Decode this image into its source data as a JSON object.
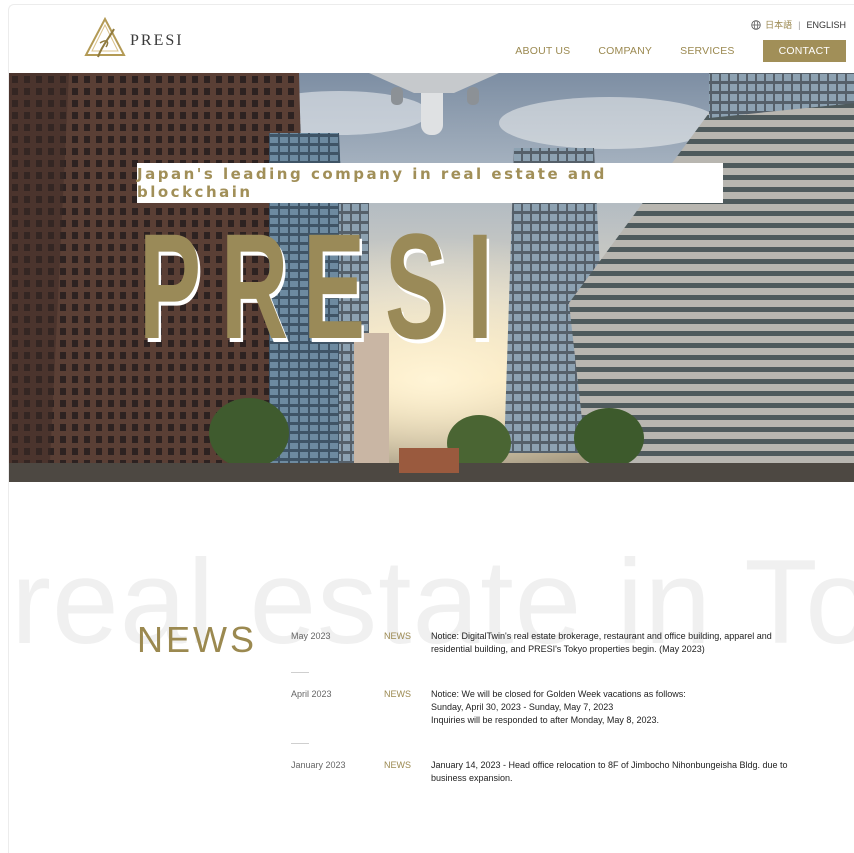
{
  "header": {
    "logo_text": "PRESI",
    "lang_japanese": "日本語",
    "lang_separator": "|",
    "lang_english": "ENGLISH",
    "nav": [
      "ABOUT US",
      "COMPANY",
      "SERVICES"
    ],
    "contact_label": "CONTACT"
  },
  "hero": {
    "tagline": "Japan's leading company in real estate and blockchain",
    "big_letters": [
      "P",
      "R",
      "E",
      "S",
      "I"
    ]
  },
  "news": {
    "watermark": "real estate in Tok",
    "title": "NEWS",
    "items": [
      {
        "date": "May 2023",
        "category": "NEWS",
        "lines": [
          "Notice: DigitalTwin's real estate brokerage, restaurant and office building, apparel and",
          "residential building, and PRESI's Tokyo properties begin. (May 2023)"
        ]
      },
      {
        "date": "April 2023",
        "category": "NEWS",
        "lines": [
          "Notice: We will be closed for Golden Week vacations as follows:",
          "Sunday, April 30, 2023 - Sunday, May 7, 2023",
          "Inquiries will be responded to after Monday, May 8, 2023."
        ]
      },
      {
        "date": "January 2023",
        "category": "NEWS",
        "lines": [
          "January 14, 2023 - Head office relocation to 8F of Jimbocho Nihonbungeisha Bldg. due to",
          "business expansion."
        ]
      }
    ]
  },
  "colors": {
    "accent_gold": "#a18f58",
    "text_gold": "#9b8950",
    "watermark_gray": "#f0f0f0"
  }
}
